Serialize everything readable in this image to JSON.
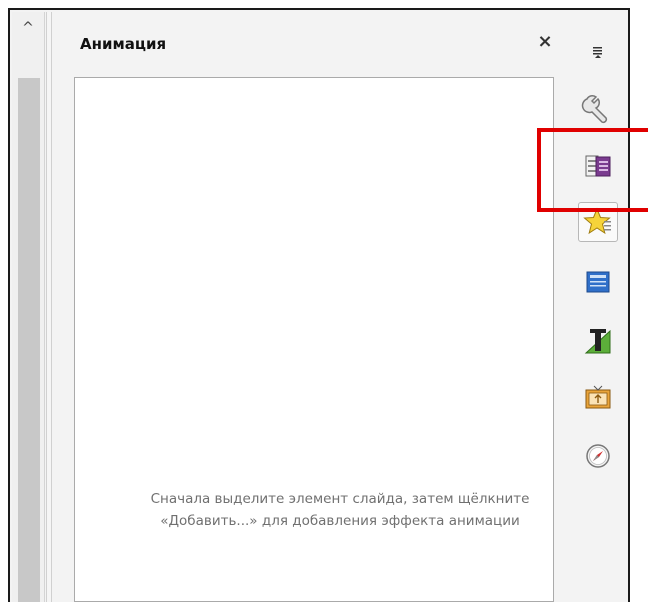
{
  "panel": {
    "title": "Анимация",
    "hint_line1": "Сначала выделите элемент слайда, затем щёлкните",
    "hint_line2": "«Добавить...» для добавления эффекта анимации"
  },
  "icons": {
    "scroll_up": "^",
    "close": "×"
  },
  "sidebar": {
    "items": [
      {
        "name": "sidebar-menu-icon"
      },
      {
        "name": "wrench-properties-icon"
      },
      {
        "name": "slide-transition-icon"
      },
      {
        "name": "animation-star-icon",
        "selected": true
      },
      {
        "name": "master-slides-icon"
      },
      {
        "name": "styles-icon"
      },
      {
        "name": "gallery-icon"
      },
      {
        "name": "navigator-compass-icon"
      }
    ]
  },
  "colors": {
    "highlight": "#e00000",
    "accent_purple": "#7a3b8f",
    "accent_blue": "#2f6fc9"
  }
}
